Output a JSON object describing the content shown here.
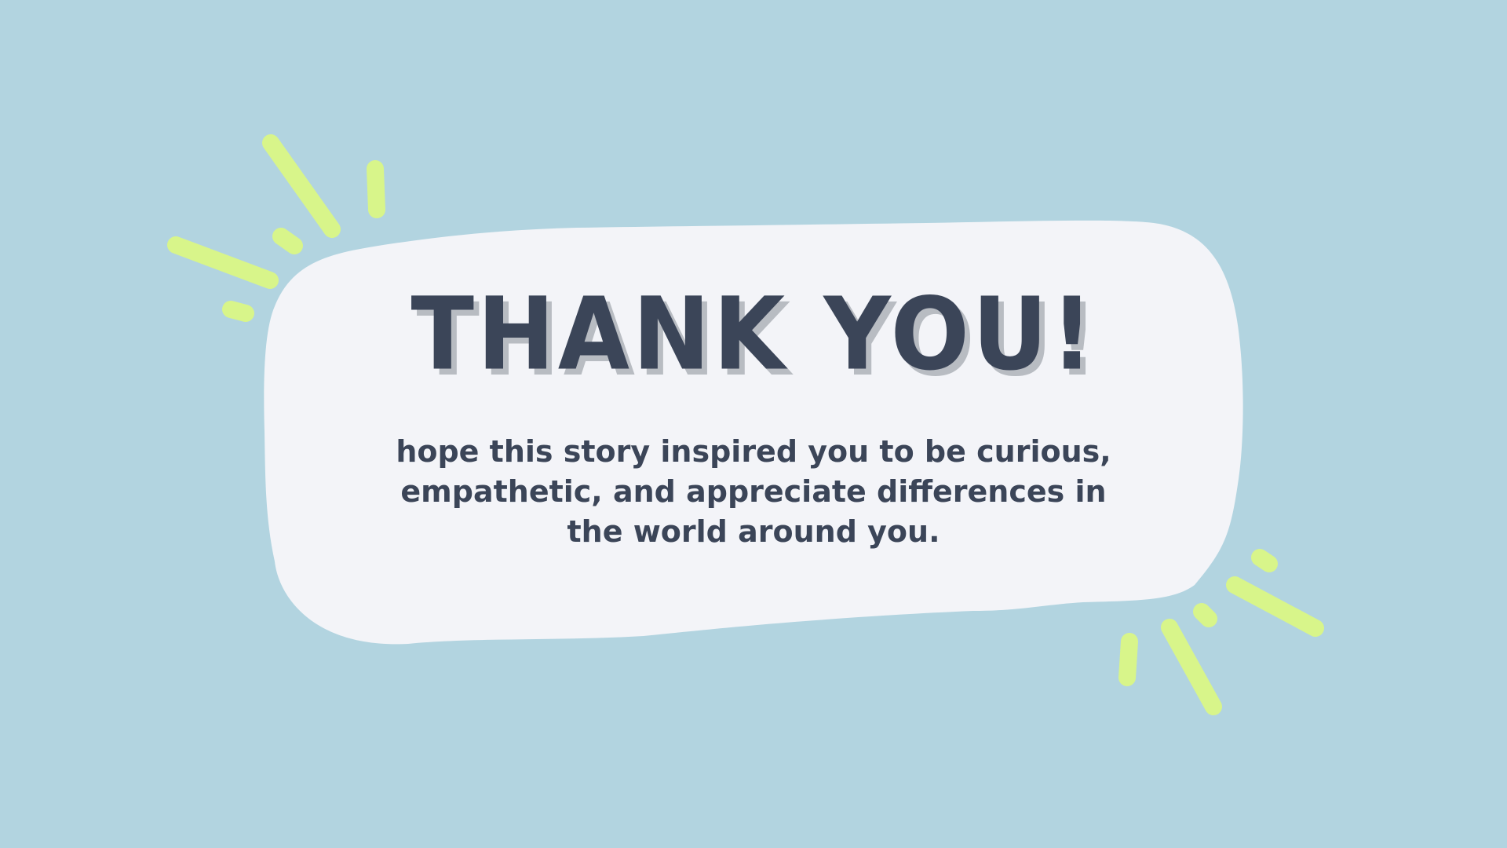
{
  "slide": {
    "title": "THANK YOU!",
    "message": "hope this story inspired you to be curious, empathetic, and appreciate differences in the world around you."
  },
  "colors": {
    "background": "#b2d4e0",
    "bubble": "#f3f4f8",
    "text": "#3b4558",
    "title_shadow": "#b8bcc2",
    "accent_lines": "#d8f58a"
  },
  "icons": {
    "speech_bubble": "speech-bubble-shape",
    "sparkle_left": "sparkle-burst-icon",
    "sparkle_right": "sparkle-burst-icon"
  }
}
